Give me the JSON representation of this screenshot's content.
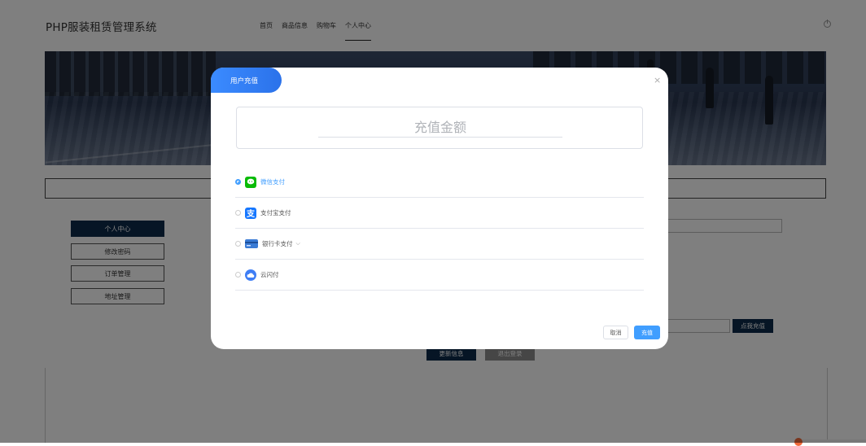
{
  "header": {
    "site_title": "PHP服装租赁管理系统",
    "nav": [
      "首页",
      "商品信息",
      "购物车",
      "个人中心"
    ]
  },
  "sidebar": {
    "items": [
      {
        "label": "个人中心"
      },
      {
        "label": "修改密码"
      },
      {
        "label": "订单管理"
      },
      {
        "label": "地址管理"
      }
    ]
  },
  "main": {
    "charge_button": "点我充值",
    "update_button": "更新信息",
    "logout_button": "退出登录"
  },
  "dialog": {
    "title": "用户充值",
    "amount_placeholder": "充值金额",
    "payment_methods": [
      {
        "label": "微信支付",
        "icon": "wechat-pay-icon",
        "color": "#09bb07",
        "selected": true
      },
      {
        "label": "支付宝支付",
        "icon": "alipay-icon",
        "color": "#1677ff",
        "selected": false
      },
      {
        "label": "银行卡支付",
        "icon": "bank-card-icon",
        "color": "#3a7bd5",
        "selected": false
      },
      {
        "label": "云闪付",
        "icon": "unionpay-cloud-icon",
        "color": "#3f7ef5",
        "selected": false
      }
    ],
    "cancel_label": "取消",
    "confirm_label": "充值"
  },
  "colors": {
    "primary": "#409eff",
    "dark_navy": "#0c2a4a"
  }
}
